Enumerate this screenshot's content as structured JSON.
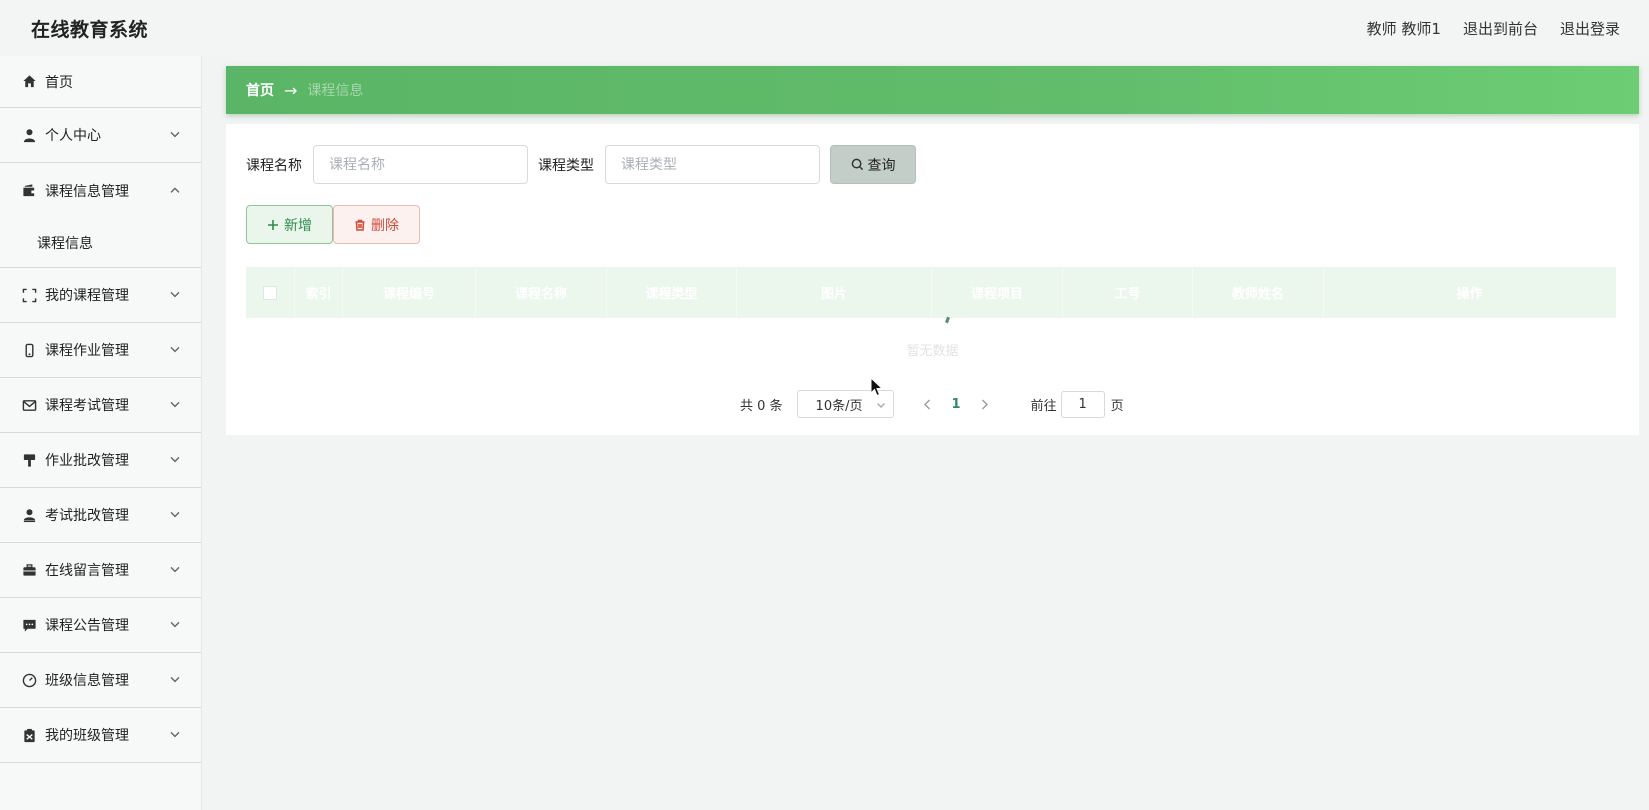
{
  "header": {
    "app_title": "在线教育系统",
    "user": "教师 教师1",
    "exit_front": "退出到前台",
    "logout": "退出登录"
  },
  "sidebar": {
    "items": [
      {
        "label": "首页",
        "icon": "home-icon"
      },
      {
        "label": "个人中心",
        "icon": "user-icon"
      },
      {
        "label": "课程信息管理",
        "icon": "wallet-icon",
        "expanded": true,
        "children": [
          {
            "label": "课程信息"
          }
        ]
      },
      {
        "label": "我的课程管理",
        "icon": "frame-icon"
      },
      {
        "label": "课程作业管理",
        "icon": "phone-icon"
      },
      {
        "label": "课程考试管理",
        "icon": "mail-icon"
      },
      {
        "label": "作业批改管理",
        "icon": "brush-icon"
      },
      {
        "label": "考试批改管理",
        "icon": "person-stamp-icon"
      },
      {
        "label": "在线留言管理",
        "icon": "suitcase-icon"
      },
      {
        "label": "课程公告管理",
        "icon": "chat-icon"
      },
      {
        "label": "班级信息管理",
        "icon": "gauge-icon"
      },
      {
        "label": "我的班级管理",
        "icon": "clipboard-icon"
      }
    ]
  },
  "breadcrumb": {
    "home": "首页",
    "separator": "→",
    "current": "课程信息"
  },
  "search": {
    "course_name_label": "课程名称",
    "course_name_placeholder": "课程名称",
    "course_type_label": "课程类型",
    "course_type_placeholder": "课程类型",
    "query_button": "查询"
  },
  "actions": {
    "add": "新增",
    "delete": "删除"
  },
  "table": {
    "columns": [
      "索引",
      "课程编号",
      "课程名称",
      "课程类型",
      "图片",
      "课程项目",
      "工号",
      "教师姓名",
      "操作"
    ],
    "empty_text": "暂无数据"
  },
  "pager": {
    "total": "共 0 条",
    "page_size": "10条/页",
    "current_page": "1",
    "goto_label": "前往",
    "goto_value": "1",
    "page_suffix": "页"
  },
  "colors": {
    "accent_green": "#62bd6a",
    "page_active": "#2e8a6a"
  }
}
